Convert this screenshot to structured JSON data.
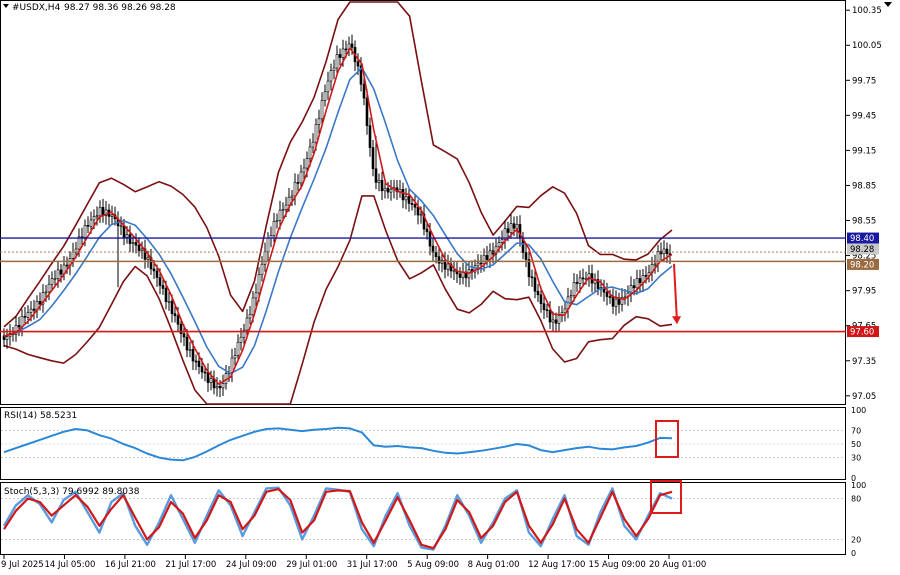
{
  "header": {
    "title": "#USDX,H4",
    "ohlc": "98.27 98.36 98.26 98.28"
  },
  "colors": {
    "candle": "#000000",
    "bb": "#7a1010",
    "ma_fast": "#d01818",
    "ma_slow": "#3a78c8",
    "level_blue": "#1a1aa0",
    "level_brown": "#9c6a40",
    "level_red": "#d01818",
    "rsi": "#2b88d8",
    "stoch_main": "#5a9ade",
    "stoch_signal": "#d01818",
    "marker": "#e01a1a"
  },
  "price_axis": {
    "ticks": [
      "100.35",
      "100.05",
      "99.75",
      "99.45",
      "99.15",
      "98.85",
      "98.55",
      "98.25",
      "97.95",
      "97.65",
      "97.35",
      "97.05"
    ]
  },
  "level_labels": {
    "blue": "98.40",
    "brown1": "98.28",
    "brown2": "98.20",
    "red": "97.60"
  },
  "rsi_panel": {
    "label": "RSI(14) 58.5231",
    "ticks": [
      "100",
      "70",
      "50",
      "30",
      "0"
    ]
  },
  "stoch_panel": {
    "label": "Stoch(5,3,3) 79.6992 89.8038",
    "ticks": [
      "100",
      "80",
      "20",
      "0"
    ]
  },
  "time_axis": {
    "labels": [
      "9 Jul 2025",
      "14 Jul 05:00",
      "16 Jul 21:00",
      "21 Jul 17:00",
      "24 Jul 09:00",
      "29 Jul 01:00",
      "31 Jul 17:00",
      "5 Aug 09:00",
      "8 Aug 01:00",
      "12 Aug 17:00",
      "15 Aug 09:00",
      "20 Aug 01:00"
    ]
  },
  "chart_data": {
    "type": "candlestick",
    "symbol": "#USDX",
    "timeframe": "H4",
    "close_series": [
      97.56,
      97.62,
      97.75,
      97.88,
      98.02,
      98.15,
      98.32,
      98.5,
      98.66,
      98.58,
      98.45,
      98.35,
      98.2,
      98.05,
      97.78,
      97.55,
      97.36,
      97.18,
      97.12,
      97.3,
      97.58,
      97.92,
      98.32,
      98.62,
      98.75,
      98.95,
      99.3,
      99.68,
      99.97,
      100.08,
      99.7,
      98.95,
      98.78,
      98.82,
      98.72,
      98.55,
      98.28,
      98.15,
      98.08,
      98.12,
      98.18,
      98.3,
      98.45,
      98.5,
      98.12,
      97.82,
      97.68,
      97.8,
      98.02,
      98.1,
      97.95,
      97.85,
      97.9,
      98.0,
      98.12,
      98.28,
      98.24
    ],
    "ohlc_last": {
      "open": 98.27,
      "high": 98.36,
      "low": 98.26,
      "close": 98.28
    },
    "price_range": [
      96.98,
      100.42
    ],
    "levels": [
      98.4,
      98.28,
      98.2,
      97.6
    ],
    "rsi_series": [
      38,
      44,
      50,
      56,
      62,
      68,
      72,
      70,
      63,
      58,
      50,
      44,
      36,
      30,
      27,
      26,
      31,
      39,
      48,
      56,
      62,
      68,
      72,
      73,
      71,
      69,
      71,
      72,
      74,
      73,
      67,
      48,
      46,
      47,
      45,
      44,
      40,
      37,
      36,
      38,
      40,
      43,
      46,
      50,
      48,
      41,
      38,
      41,
      44,
      46,
      43,
      42,
      45,
      47,
      52,
      59,
      58.5
    ],
    "stoch_k": [
      40,
      70,
      85,
      72,
      45,
      78,
      90,
      60,
      30,
      75,
      88,
      40,
      12,
      45,
      85,
      50,
      15,
      55,
      92,
      70,
      25,
      60,
      95,
      96,
      70,
      20,
      55,
      95,
      93,
      90,
      35,
      10,
      55,
      88,
      40,
      8,
      5,
      40,
      85,
      55,
      15,
      45,
      80,
      92,
      30,
      10,
      50,
      85,
      25,
      12,
      60,
      95,
      40,
      20,
      55,
      88,
      80
    ],
    "stoch_d": [
      35,
      62,
      80,
      75,
      55,
      70,
      85,
      68,
      40,
      65,
      85,
      52,
      20,
      38,
      75,
      58,
      22,
      48,
      85,
      75,
      35,
      55,
      90,
      94,
      78,
      30,
      48,
      90,
      92,
      91,
      45,
      15,
      48,
      82,
      48,
      12,
      7,
      35,
      78,
      60,
      22,
      40,
      75,
      90,
      40,
      15,
      42,
      80,
      35,
      15,
      52,
      90,
      50,
      25,
      50,
      85,
      90
    ]
  }
}
